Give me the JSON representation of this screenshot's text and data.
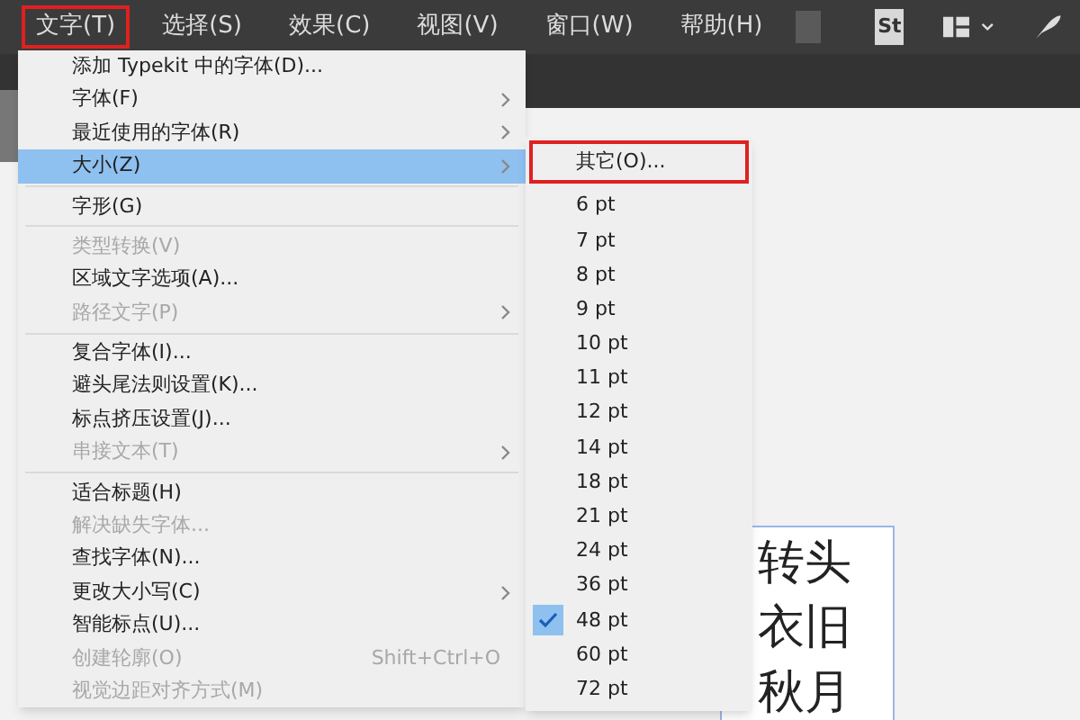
{
  "menubar": [
    {
      "label": "文字(T)",
      "selected": true
    },
    {
      "label": "选择(S)",
      "selected": false
    },
    {
      "label": "效果(C)",
      "selected": false
    },
    {
      "label": "视图(V)",
      "selected": false
    },
    {
      "label": "窗口(W)",
      "selected": false
    },
    {
      "label": "帮助(H)",
      "selected": false
    }
  ],
  "toolbar": {
    "stock_badge": "St"
  },
  "menu": [
    {
      "kind": "item",
      "label": "添加 Typekit 中的字体(D)...",
      "disabled": false,
      "submenu": false,
      "highlighted": false
    },
    {
      "kind": "item",
      "label": "字体(F)",
      "disabled": false,
      "submenu": true,
      "highlighted": false
    },
    {
      "kind": "item",
      "label": "最近使用的字体(R)",
      "disabled": false,
      "submenu": true,
      "highlighted": false
    },
    {
      "kind": "item",
      "label": "大小(Z)",
      "disabled": false,
      "submenu": true,
      "highlighted": true
    },
    {
      "kind": "separator"
    },
    {
      "kind": "item",
      "label": "字形(G)",
      "disabled": false,
      "submenu": false,
      "highlighted": false
    },
    {
      "kind": "separator"
    },
    {
      "kind": "item",
      "label": "类型转换(V)",
      "disabled": true,
      "submenu": false,
      "highlighted": false
    },
    {
      "kind": "item",
      "label": "区域文字选项(A)...",
      "disabled": false,
      "submenu": false,
      "highlighted": false
    },
    {
      "kind": "item",
      "label": "路径文字(P)",
      "disabled": true,
      "submenu": true,
      "highlighted": false
    },
    {
      "kind": "separator"
    },
    {
      "kind": "item",
      "label": "复合字体(I)...",
      "disabled": false,
      "submenu": false,
      "highlighted": false
    },
    {
      "kind": "item",
      "label": "避头尾法则设置(K)...",
      "disabled": false,
      "submenu": false,
      "highlighted": false
    },
    {
      "kind": "item",
      "label": "标点挤压设置(J)...",
      "disabled": false,
      "submenu": false,
      "highlighted": false
    },
    {
      "kind": "item",
      "label": "串接文本(T)",
      "disabled": true,
      "submenu": true,
      "highlighted": false
    },
    {
      "kind": "separator"
    },
    {
      "kind": "item",
      "label": "适合标题(H)",
      "disabled": false,
      "submenu": false,
      "highlighted": false
    },
    {
      "kind": "item",
      "label": "解决缺失字体...",
      "disabled": true,
      "submenu": false,
      "highlighted": false
    },
    {
      "kind": "item",
      "label": "查找字体(N)...",
      "disabled": false,
      "submenu": false,
      "highlighted": false
    },
    {
      "kind": "item",
      "label": "更改大小写(C)",
      "disabled": false,
      "submenu": true,
      "highlighted": false
    },
    {
      "kind": "item",
      "label": "智能标点(U)...",
      "disabled": false,
      "submenu": false,
      "highlighted": false
    },
    {
      "kind": "item",
      "label": "创建轮廓(O)",
      "disabled": true,
      "submenu": false,
      "highlighted": false,
      "shortcut": "Shift+Ctrl+O"
    },
    {
      "kind": "item",
      "label": "视觉边距对齐方式(M)",
      "disabled": true,
      "submenu": false,
      "highlighted": false
    }
  ],
  "size_submenu": [
    {
      "label": "其它(O)...",
      "checked": false,
      "outlined": true
    },
    {
      "label": "6 pt",
      "checked": false,
      "outlined": false
    },
    {
      "label": "7 pt",
      "checked": false,
      "outlined": false
    },
    {
      "label": "8 pt",
      "checked": false,
      "outlined": false
    },
    {
      "label": "9 pt",
      "checked": false,
      "outlined": false
    },
    {
      "label": "10 pt",
      "checked": false,
      "outlined": false
    },
    {
      "label": "11 pt",
      "checked": false,
      "outlined": false
    },
    {
      "label": "12 pt",
      "checked": false,
      "outlined": false
    },
    {
      "label": "14 pt",
      "checked": false,
      "outlined": false
    },
    {
      "label": "18 pt",
      "checked": false,
      "outlined": false
    },
    {
      "label": "21 pt",
      "checked": false,
      "outlined": false
    },
    {
      "label": "24 pt",
      "checked": false,
      "outlined": false
    },
    {
      "label": "36 pt",
      "checked": false,
      "outlined": false
    },
    {
      "label": "48 pt",
      "checked": true,
      "outlined": false
    },
    {
      "label": "60 pt",
      "checked": false,
      "outlined": false
    },
    {
      "label": "72 pt",
      "checked": false,
      "outlined": false
    }
  ],
  "canvas_text": [
    "转头",
    "衣旧",
    "秋月"
  ]
}
